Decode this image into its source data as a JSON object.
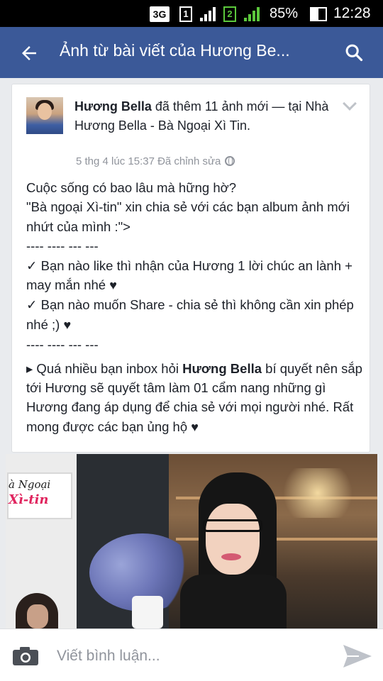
{
  "status_bar": {
    "network": "3G",
    "sim1": "1",
    "sim2": "2",
    "battery": "85%",
    "time": "12:28"
  },
  "app_bar": {
    "title": "Ảnh từ bài viết của Hương Be...",
    "back_icon": "arrow-left-icon",
    "search_icon": "search-icon",
    "color": "#3b5998"
  },
  "post": {
    "author": "Hương Bella",
    "action": " đã thêm 11 ảnh mới — tại Nhà Hương Bella - Bà Ngoại Xì Tin.",
    "meta": "5 thg 4 lúc 15:37 Đã chỉnh sửa",
    "privacy_icon": "globe-icon",
    "lines": {
      "l1": "Cuộc sống có bao lâu mà hững hờ?",
      "l2": "\"Bà ngoại Xì-tin\" xin chia sẻ với các bạn album ảnh mới nhứt của mình :\">",
      "sep1": "---- ---- ---  ---",
      "l3": "✓  Bạn nào like thì nhận của Hương 1 lời chúc an lành + may mắn nhé ",
      "l4": "✓  Bạn nào muốn Share - chia sẻ thì không cần xin phép nhé ;) ",
      "sep2": "---- ---- ---  ---",
      "l5_pre": "▸ Quá nhiều bạn inbox hỏi ",
      "l5_bold": "Hương Bella",
      "l5_post": " bí quyết nên sắp tới Hương sẽ quyết tâm làm 01 cẩm nang những gì Hương đang áp dụng để chia sẻ với mọi người nhé. Rất mong được các bạn ủng hộ ",
      "heart": "♥"
    },
    "photo_sign": {
      "line1": "à Ngoại",
      "line2": "Xì-tin"
    }
  },
  "comment_bar": {
    "placeholder": "Viết bình luận...",
    "camera_icon": "camera-icon",
    "send_icon": "send-icon"
  }
}
